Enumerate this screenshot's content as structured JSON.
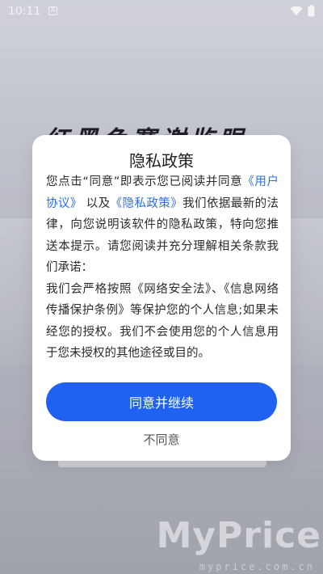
{
  "status_bar": {
    "time": "10:11",
    "icons": [
      "notification-icon",
      "wifi-icon",
      "battery-icon"
    ]
  },
  "background": {
    "title": "红黑色赛谢监眼"
  },
  "dialog": {
    "title": "隐私政策",
    "body": {
      "p1_before_user_agreement": "您点击“同意”即表示您已阅读并同意",
      "user_agreement_link": "《用户协议》",
      "and": "以及",
      "privacy_policy_link": "《隐私政策》",
      "p1_after": "我们依据最新的法律，向您说明该软件的隐私政策，特向您推送本提示。请您阅读并充分理解相关条款我们承诺：",
      "p2": "我们会严格按照《网络安全法》、《信息网络传播保护条例》等保护您的个人信息;如果未经您的授权。我们不会使用您的个人信息用于您未授权的其他途径或目的。"
    },
    "agree_button_label": "同意并继续",
    "disagree_label": "不同意"
  },
  "watermark": {
    "text": "MyPrice",
    "sub": "myprice.com.cn"
  },
  "colors": {
    "link": "#2c6fe4",
    "primary_button": "#1f62f2"
  }
}
